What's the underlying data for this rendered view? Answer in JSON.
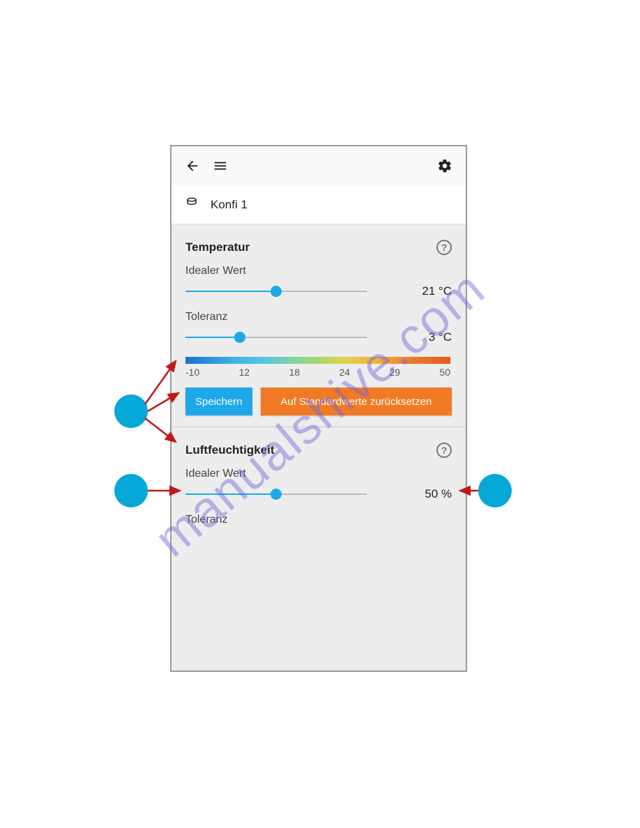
{
  "watermark": "manualshive.com",
  "header": {
    "gap": " "
  },
  "title": {
    "label": "Konfi 1"
  },
  "sections": {
    "temp": {
      "title": "Temperatur",
      "ideal_label": "Idealer Wert",
      "ideal_value": "21 °C",
      "ideal_percent": 50,
      "tol_label": "Toleranz",
      "tol_value": "3 °C",
      "tol_percent": 30,
      "scale": [
        "-10",
        "12",
        "18",
        "24",
        "29",
        "50"
      ]
    },
    "humidity": {
      "title": "Luftfeuchtigkeit",
      "ideal_label": "Idealer Wert",
      "ideal_value": "50 %",
      "ideal_percent": 50,
      "tol_label": "Toleranz"
    }
  },
  "buttons": {
    "save": "Speichern",
    "reset": "Auf Standardwerte zurücksetzen"
  }
}
